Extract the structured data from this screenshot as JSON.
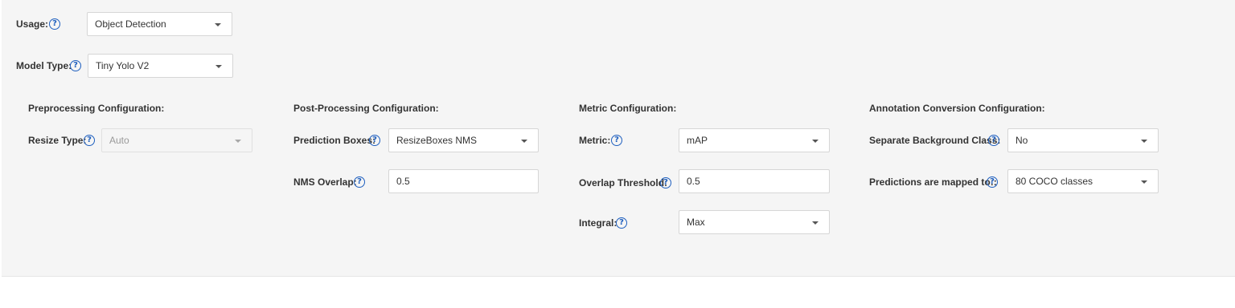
{
  "usage": {
    "label": "Usage:",
    "value": "Object Detection"
  },
  "model_type": {
    "label": "Model Type:",
    "value": "Tiny Yolo V2"
  },
  "preprocessing": {
    "title": "Preprocessing Configuration:",
    "resize_type": {
      "label": "Resize Type:",
      "value": "Auto"
    }
  },
  "postprocessing": {
    "title": "Post-Processing Configuration:",
    "prediction_boxes": {
      "label": "Prediction Boxes:",
      "value": "ResizeBoxes NMS"
    },
    "nms_overlap": {
      "label": "NMS Overlap:",
      "value": "0.5"
    }
  },
  "metric": {
    "title": "Metric Configuration:",
    "metric": {
      "label": "Metric:",
      "value": "mAP"
    },
    "overlap_threshold": {
      "label": "Overlap Threshold:",
      "value": "0.5"
    },
    "integral": {
      "label": "Integral:",
      "value": "Max"
    }
  },
  "annotation": {
    "title": "Annotation Conversion Configuration:",
    "separate_background": {
      "label": "Separate Background Class:",
      "value": "No"
    },
    "predictions_mapped": {
      "label": "Predictions are mapped to::",
      "value": "80 COCO classes"
    }
  },
  "help_glyph": "?",
  "colors": {
    "accent": "#1e5fbf",
    "panel_bg": "#f5f5f5",
    "field_border": "#d6d6d6"
  }
}
